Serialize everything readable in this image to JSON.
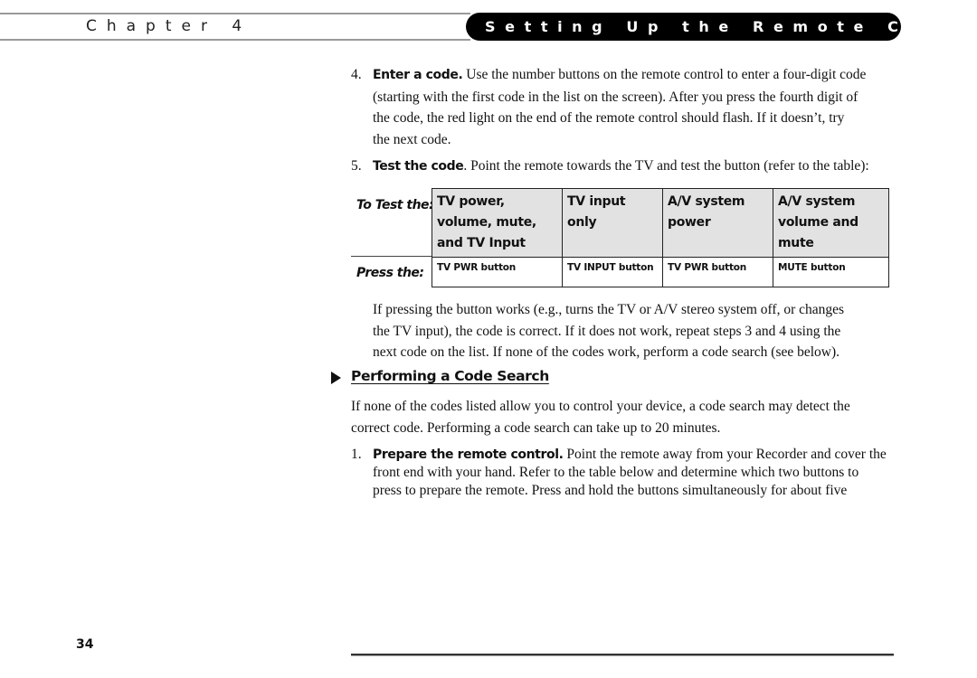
{
  "header": {
    "chapter_label": "Chapter 4",
    "section_title": "Setting Up the Remote Control"
  },
  "steps_top": [
    {
      "number": "4.",
      "lead": "Enter a code.",
      "lines": [
        " Use the number buttons on the remote control to enter a four-digit code",
        "(starting with the first code in the list on the screen). After you press the fourth digit of",
        "the code, the red light on the end of the remote control should flash. If it doesn’t, try",
        "the next code."
      ]
    },
    {
      "number": "5.",
      "lead": "Test the code",
      "lines": [
        ". Point the remote towards the TV and test the button (refer to the table):"
      ]
    }
  ],
  "test_table": {
    "row_label_test": "To Test the:",
    "row_label_press": "Press the:",
    "columns": [
      {
        "test": "TV power, volume, mute, and TV Input",
        "press": "TV PWR button"
      },
      {
        "test": "TV input only",
        "press": "TV INPUT button"
      },
      {
        "test": "A/V system power",
        "press": "TV PWR button"
      },
      {
        "test": "A/V system volume and mute",
        "press": "MUTE button"
      }
    ]
  },
  "after_table": {
    "lines": [
      "If pressing the button works (e.g., turns the TV or A/V stereo system off, or changes",
      "the TV input), the code is correct. If it does not work, repeat steps 3 and 4 using the",
      "next code on the list. If none of the codes work, perform a code search (see below)."
    ]
  },
  "section": {
    "heading": "Performing a Code Search",
    "intro_lines": [
      "If none of the codes listed allow you to control your device, a code search may detect the",
      "correct code. Performing a code search can take up to 20 minutes."
    ],
    "step1": {
      "number": "1.",
      "lead": "Prepare the remote control.",
      "lines": [
        " Point the remote away from your Recorder and cover the",
        "front end with your hand. Refer to the table below and determine which two buttons to",
        "press to prepare the remote. Press and hold the buttons simultaneously for about five"
      ]
    }
  },
  "footer": {
    "page_number": "34"
  }
}
